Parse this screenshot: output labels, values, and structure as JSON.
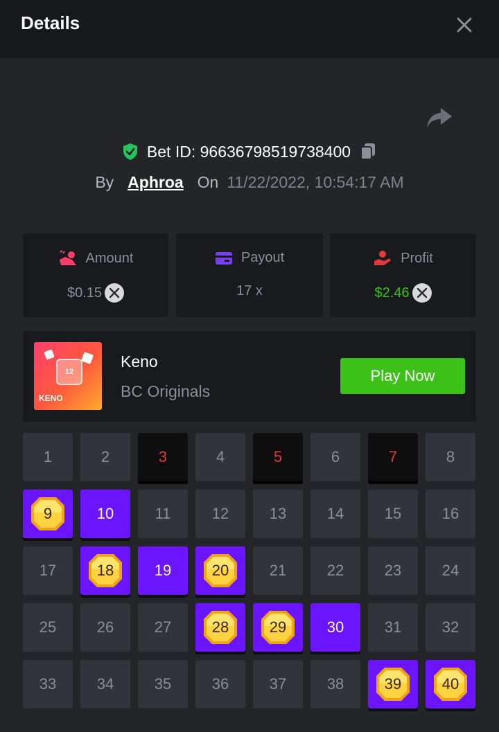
{
  "header": {
    "title": "Details"
  },
  "bet": {
    "label": "Bet ID: 96636798519738400",
    "by_label": "By",
    "user": "Aphroa",
    "on_label": "On",
    "date": "11/22/2022, 10:54:17 AM"
  },
  "stats": {
    "amount": {
      "label": "Amount",
      "value": "$0.15",
      "currency_icon": "xrp-icon"
    },
    "payout": {
      "label": "Payout",
      "value": "17 x"
    },
    "profit": {
      "label": "Profit",
      "value": "$2.46",
      "currency_icon": "xrp-icon"
    }
  },
  "game": {
    "name": "Keno",
    "provider": "BC Originals",
    "play_label": "Play Now",
    "thumb_text": "KENO",
    "thumb_number": "12"
  },
  "colors": {
    "accent_green": "#3bc117",
    "pick_purple": "#6b14ff",
    "miss_red": "#e13a3a",
    "verified_green": "#22c55e"
  },
  "grid": {
    "cells": [
      {
        "n": "1",
        "state": "normal"
      },
      {
        "n": "2",
        "state": "normal"
      },
      {
        "n": "3",
        "state": "miss"
      },
      {
        "n": "4",
        "state": "normal"
      },
      {
        "n": "5",
        "state": "miss"
      },
      {
        "n": "6",
        "state": "normal"
      },
      {
        "n": "7",
        "state": "miss"
      },
      {
        "n": "8",
        "state": "normal"
      },
      {
        "n": "9",
        "state": "hit"
      },
      {
        "n": "10",
        "state": "pick"
      },
      {
        "n": "11",
        "state": "normal"
      },
      {
        "n": "12",
        "state": "normal"
      },
      {
        "n": "13",
        "state": "normal"
      },
      {
        "n": "14",
        "state": "normal"
      },
      {
        "n": "15",
        "state": "normal"
      },
      {
        "n": "16",
        "state": "normal"
      },
      {
        "n": "17",
        "state": "normal"
      },
      {
        "n": "18",
        "state": "hit"
      },
      {
        "n": "19",
        "state": "pick"
      },
      {
        "n": "20",
        "state": "hit"
      },
      {
        "n": "21",
        "state": "normal"
      },
      {
        "n": "22",
        "state": "normal"
      },
      {
        "n": "23",
        "state": "normal"
      },
      {
        "n": "24",
        "state": "normal"
      },
      {
        "n": "25",
        "state": "normal"
      },
      {
        "n": "26",
        "state": "normal"
      },
      {
        "n": "27",
        "state": "normal"
      },
      {
        "n": "28",
        "state": "hit"
      },
      {
        "n": "29",
        "state": "hit"
      },
      {
        "n": "30",
        "state": "pick"
      },
      {
        "n": "31",
        "state": "normal"
      },
      {
        "n": "32",
        "state": "normal"
      },
      {
        "n": "33",
        "state": "normal"
      },
      {
        "n": "34",
        "state": "normal"
      },
      {
        "n": "35",
        "state": "normal"
      },
      {
        "n": "36",
        "state": "normal"
      },
      {
        "n": "37",
        "state": "normal"
      },
      {
        "n": "38",
        "state": "normal"
      },
      {
        "n": "39",
        "state": "hit"
      },
      {
        "n": "40",
        "state": "hit"
      }
    ]
  }
}
